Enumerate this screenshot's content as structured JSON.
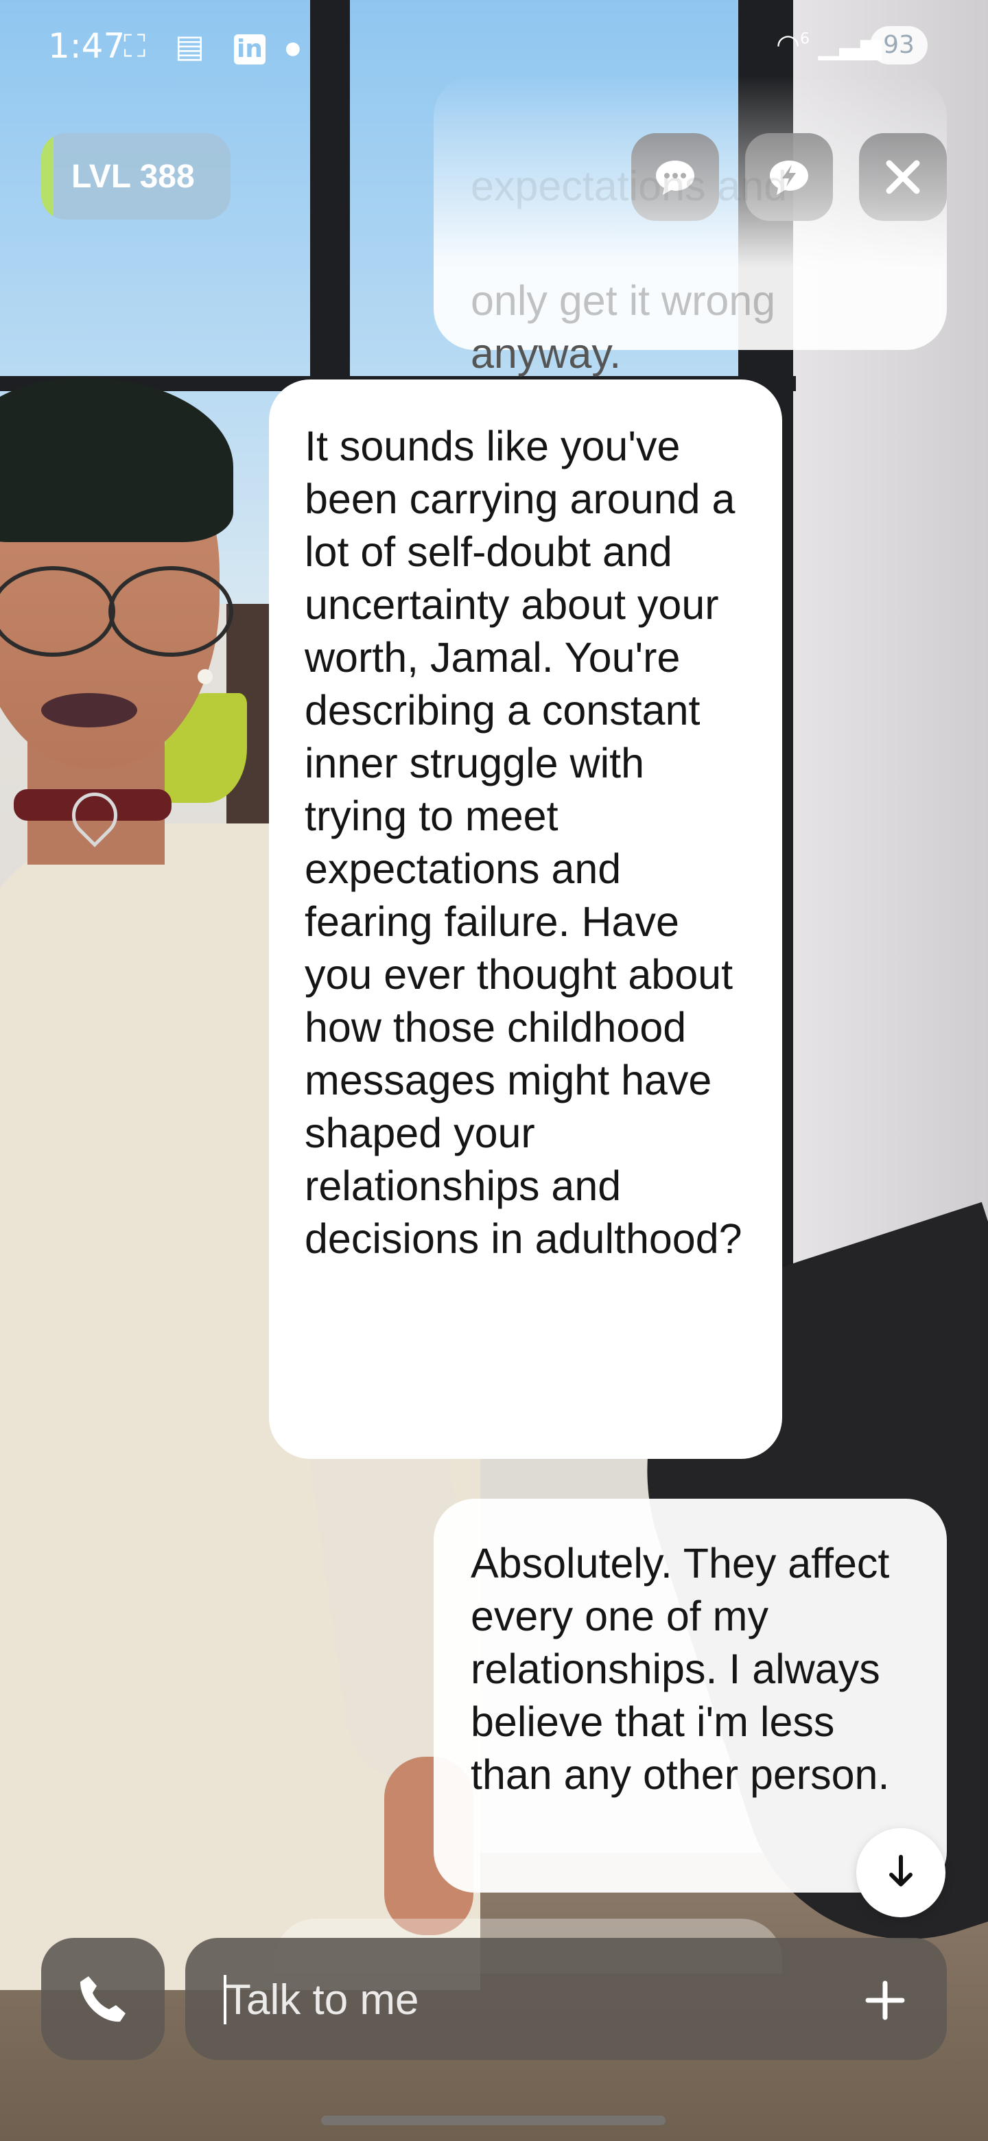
{
  "status_bar": {
    "time": "1:47",
    "left_icons": [
      "screenshot-icon",
      "bookmark-icon",
      "linkedin-icon",
      "dot-icon"
    ],
    "linkedin_label": "in",
    "right_icons": [
      "wifi-icon",
      "signal-icon"
    ],
    "wifi_badge": "6",
    "battery": "93"
  },
  "header": {
    "level_label": "LVL 388",
    "buttons": [
      {
        "name": "chat-mode-button",
        "icon": "chat-bubble-icon"
      },
      {
        "name": "quick-reply-button",
        "icon": "lightning-bubble-icon"
      },
      {
        "name": "close-button",
        "icon": "close-icon"
      }
    ]
  },
  "messages": [
    {
      "role": "user",
      "partial": true,
      "lines": [
        "expectations and",
        "only get it wrong",
        "anyway."
      ]
    },
    {
      "role": "assistant",
      "text": "It sounds like you've been carrying around a lot of self-doubt and uncertainty about your worth, Jamal. You're describing a constant inner struggle with trying to meet expectations and fearing failure. Have you ever thought about how those childhood messages might have shaped your relationships and decisions in adulthood?"
    },
    {
      "role": "user",
      "text": "Absolutely. They affect every one of my relationships. I always believe that i'm less than any other person."
    }
  ],
  "scroll_button": {
    "icon": "arrow-down-icon"
  },
  "composer": {
    "placeholder": "Talk to me",
    "value": "",
    "call_icon": "phone-icon",
    "add_icon": "plus-icon"
  },
  "colors": {
    "bubble_bg": "#ffffff",
    "control_bg": "#6e6e70",
    "composer_bg": "#5f5a54",
    "level_accent": "#b7e06a"
  }
}
